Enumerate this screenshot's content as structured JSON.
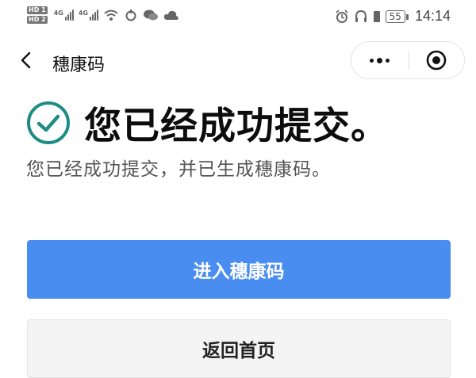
{
  "status_bar": {
    "hd1": "HD 1",
    "hd2": "HD 2",
    "net1": "4G",
    "net2": "4G",
    "battery": "55",
    "time": "14:14"
  },
  "header": {
    "title": "穗康码"
  },
  "success": {
    "title": "您已经成功提交。",
    "subtitle": "您已经成功提交，并已生成穗康码。",
    "accent_color": "#1e8c84"
  },
  "actions": {
    "primary_label": "进入穗康码",
    "secondary_label": "返回首页",
    "primary_color": "#4a8df0"
  }
}
